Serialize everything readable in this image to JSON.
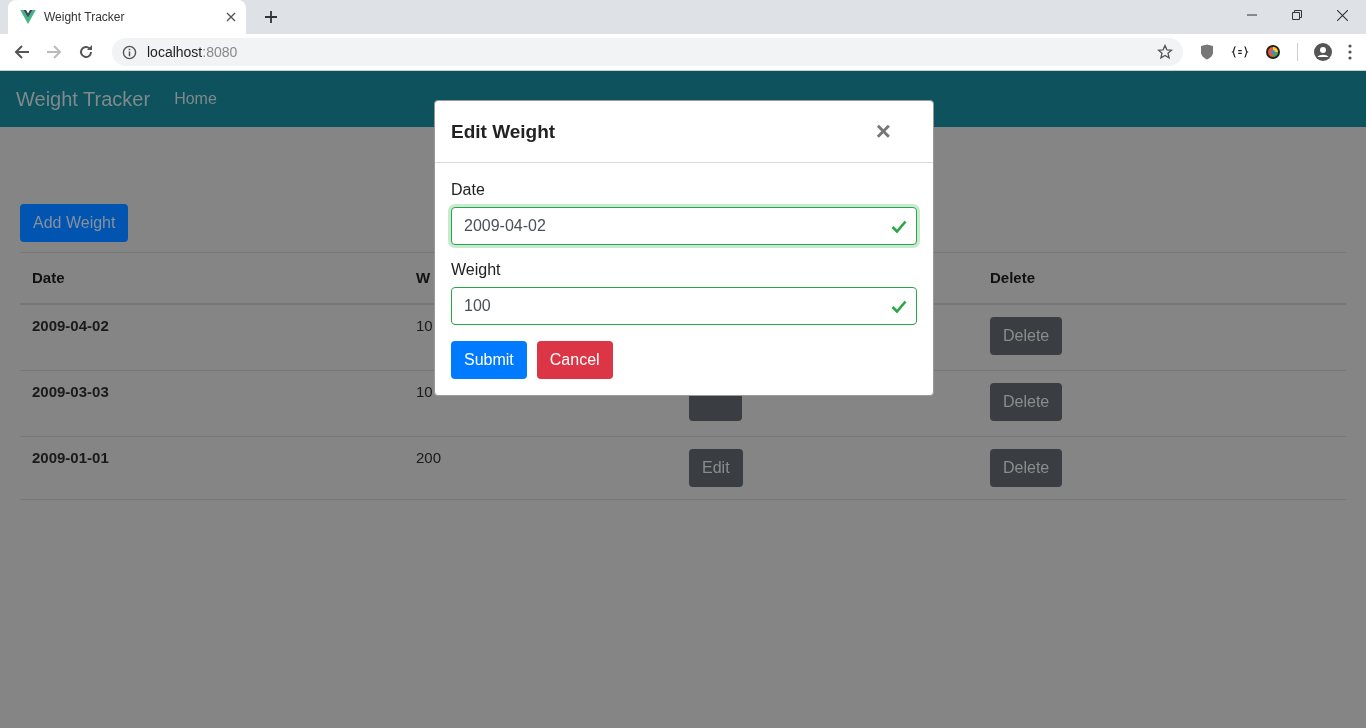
{
  "browser": {
    "tab_title": "Weight Tracker",
    "url_host": "localhost",
    "url_port": ":8080"
  },
  "navbar": {
    "brand": "Weight Tracker",
    "links": [
      {
        "label": "Home"
      }
    ]
  },
  "add_button": "Add Weight",
  "table": {
    "columns": [
      "Date",
      "W",
      "",
      "Delete"
    ],
    "rows": [
      {
        "date": "2009-04-02",
        "weight": "10",
        "delete": "Delete"
      },
      {
        "date": "2009-03-03",
        "weight": "10",
        "delete": "Delete"
      },
      {
        "date": "2009-01-01",
        "weight": "200",
        "edit": "Edit",
        "delete": "Delete"
      }
    ]
  },
  "modal": {
    "title": "Edit Weight",
    "close": "×",
    "fields": [
      {
        "label": "Date",
        "value": "2009-04-02",
        "valid": true,
        "focused": true
      },
      {
        "label": "Weight",
        "value": "100",
        "valid": true,
        "focused": false
      }
    ],
    "buttons": [
      {
        "label": "Submit",
        "kind": "primary"
      },
      {
        "label": "Cancel",
        "kind": "danger"
      }
    ]
  }
}
